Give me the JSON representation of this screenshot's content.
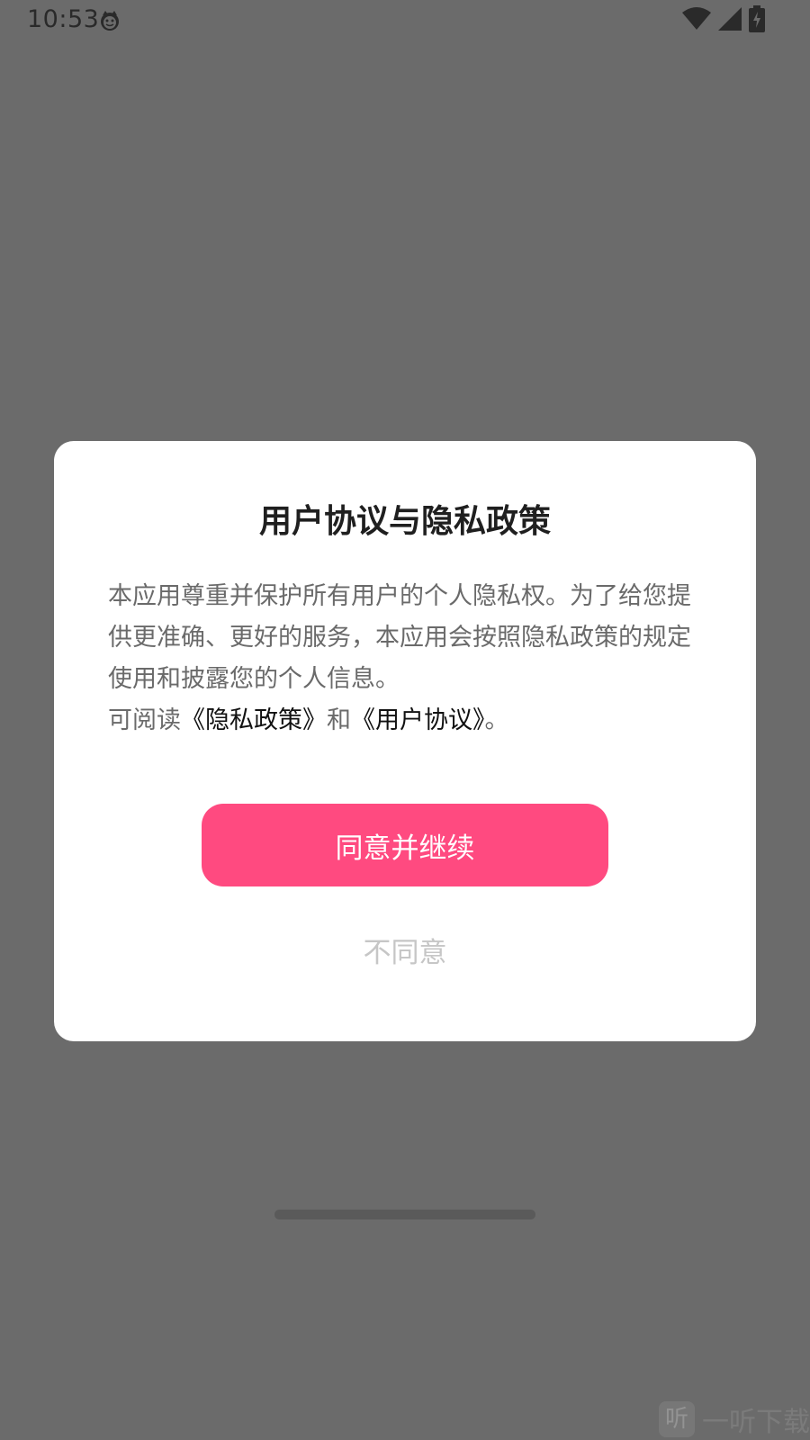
{
  "status_bar": {
    "time": "10:53",
    "app_icon": "cat-face-icon",
    "icons": [
      "wifi-icon",
      "cellular-signal-icon",
      "battery-charging-icon"
    ]
  },
  "dialog": {
    "title": "用户协议与隐私政策",
    "body_line_1": "本应用尊重并保护所有用户的个人隐私权。为了给您提供更准确、更好的服务，本应用会按照隐私政策的规定使用和披露您的个人信息。",
    "read_prefix": "可阅读",
    "privacy_link": "《隐私政策》",
    "conjunction": "和",
    "user_agreement_link": "《用户协议》",
    "read_suffix": "。",
    "agree_button": "同意并继续",
    "disagree_button": "不同意",
    "accent_color": "#ff4a80"
  },
  "watermark": {
    "logo_char": "听",
    "text": "一听下载"
  }
}
